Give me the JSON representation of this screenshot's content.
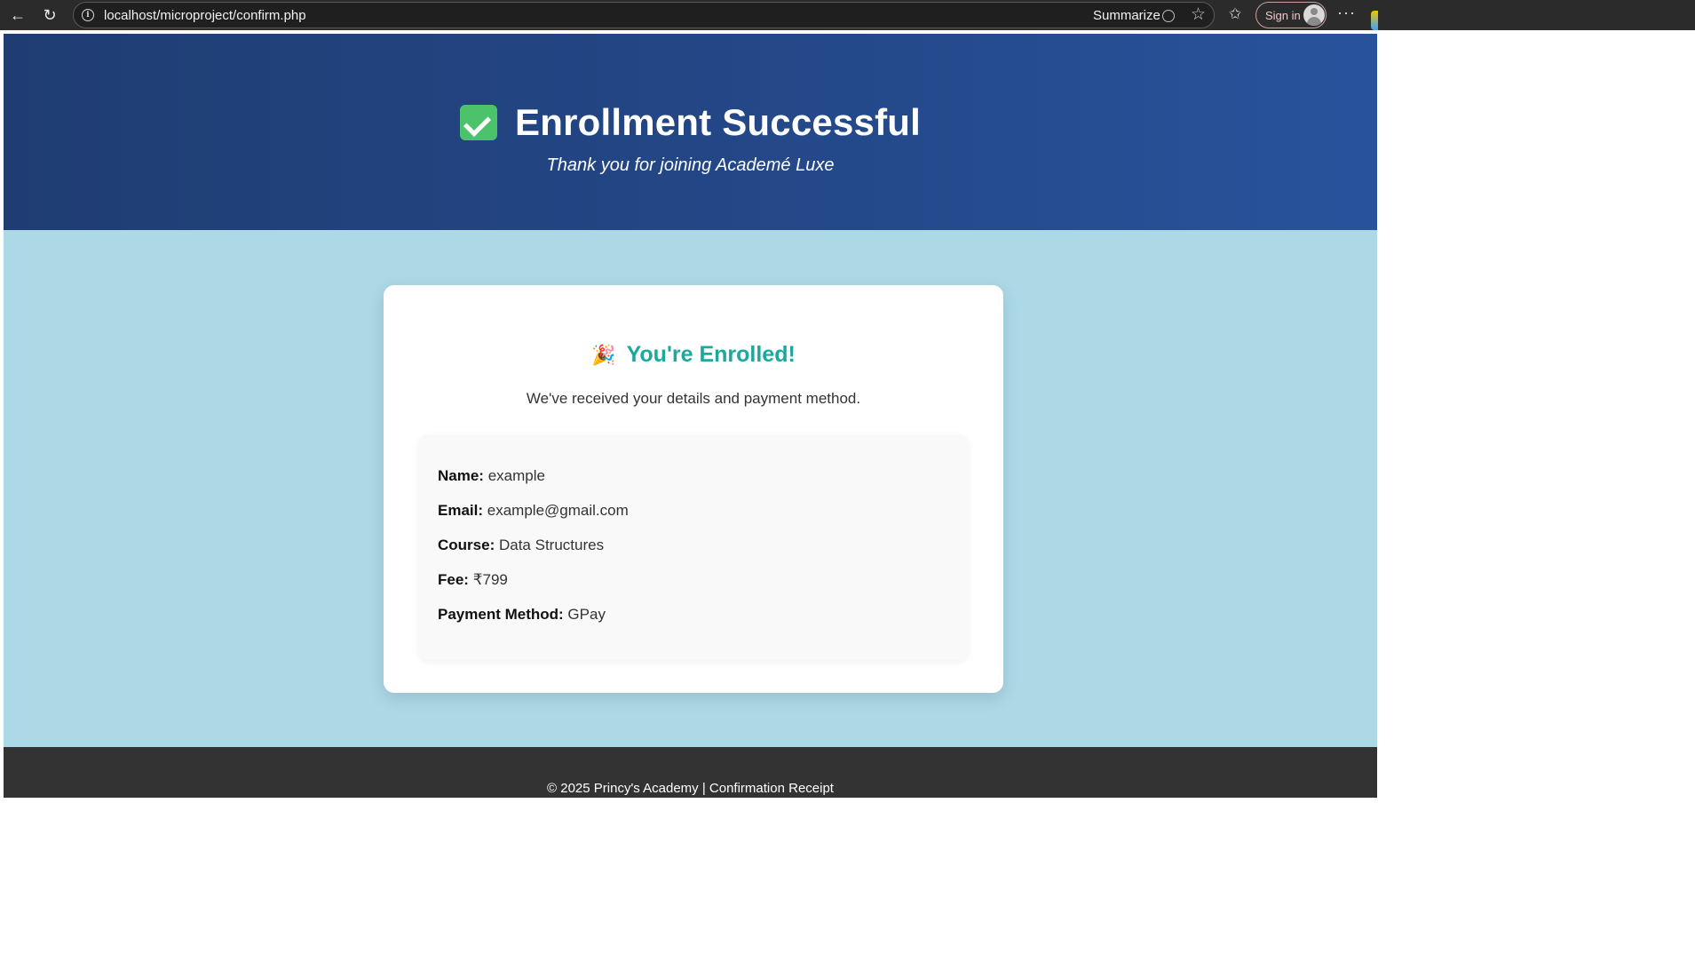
{
  "browser": {
    "url": "localhost/microproject/confirm.php",
    "summarize_label": "Summarize",
    "signin_label": "Sign in",
    "more_label": "···"
  },
  "hero": {
    "title": "Enrollment Successful",
    "subtitle": "Thank you for joining Academé Luxe",
    "icon": "check-mark-icon"
  },
  "card": {
    "title": "You're Enrolled!",
    "title_icon": "party-popper-icon",
    "subtitle": "We've received your details and payment method.",
    "details": [
      {
        "label": "Name:",
        "value": "example"
      },
      {
        "label": "Email:",
        "value": "example@gmail.com"
      },
      {
        "label": "Course:",
        "value": "Data Structures"
      },
      {
        "label": "Fee:",
        "value": "₹799"
      },
      {
        "label": "Payment Method:",
        "value": "GPay"
      }
    ]
  },
  "footer": {
    "text": "© 2025 Princy's Academy | Confirmation Receipt"
  },
  "colors": {
    "hero_bg": "#234685",
    "content_bg": "#add8e6",
    "accent": "#1aa99c",
    "footer_bg": "#333333"
  }
}
